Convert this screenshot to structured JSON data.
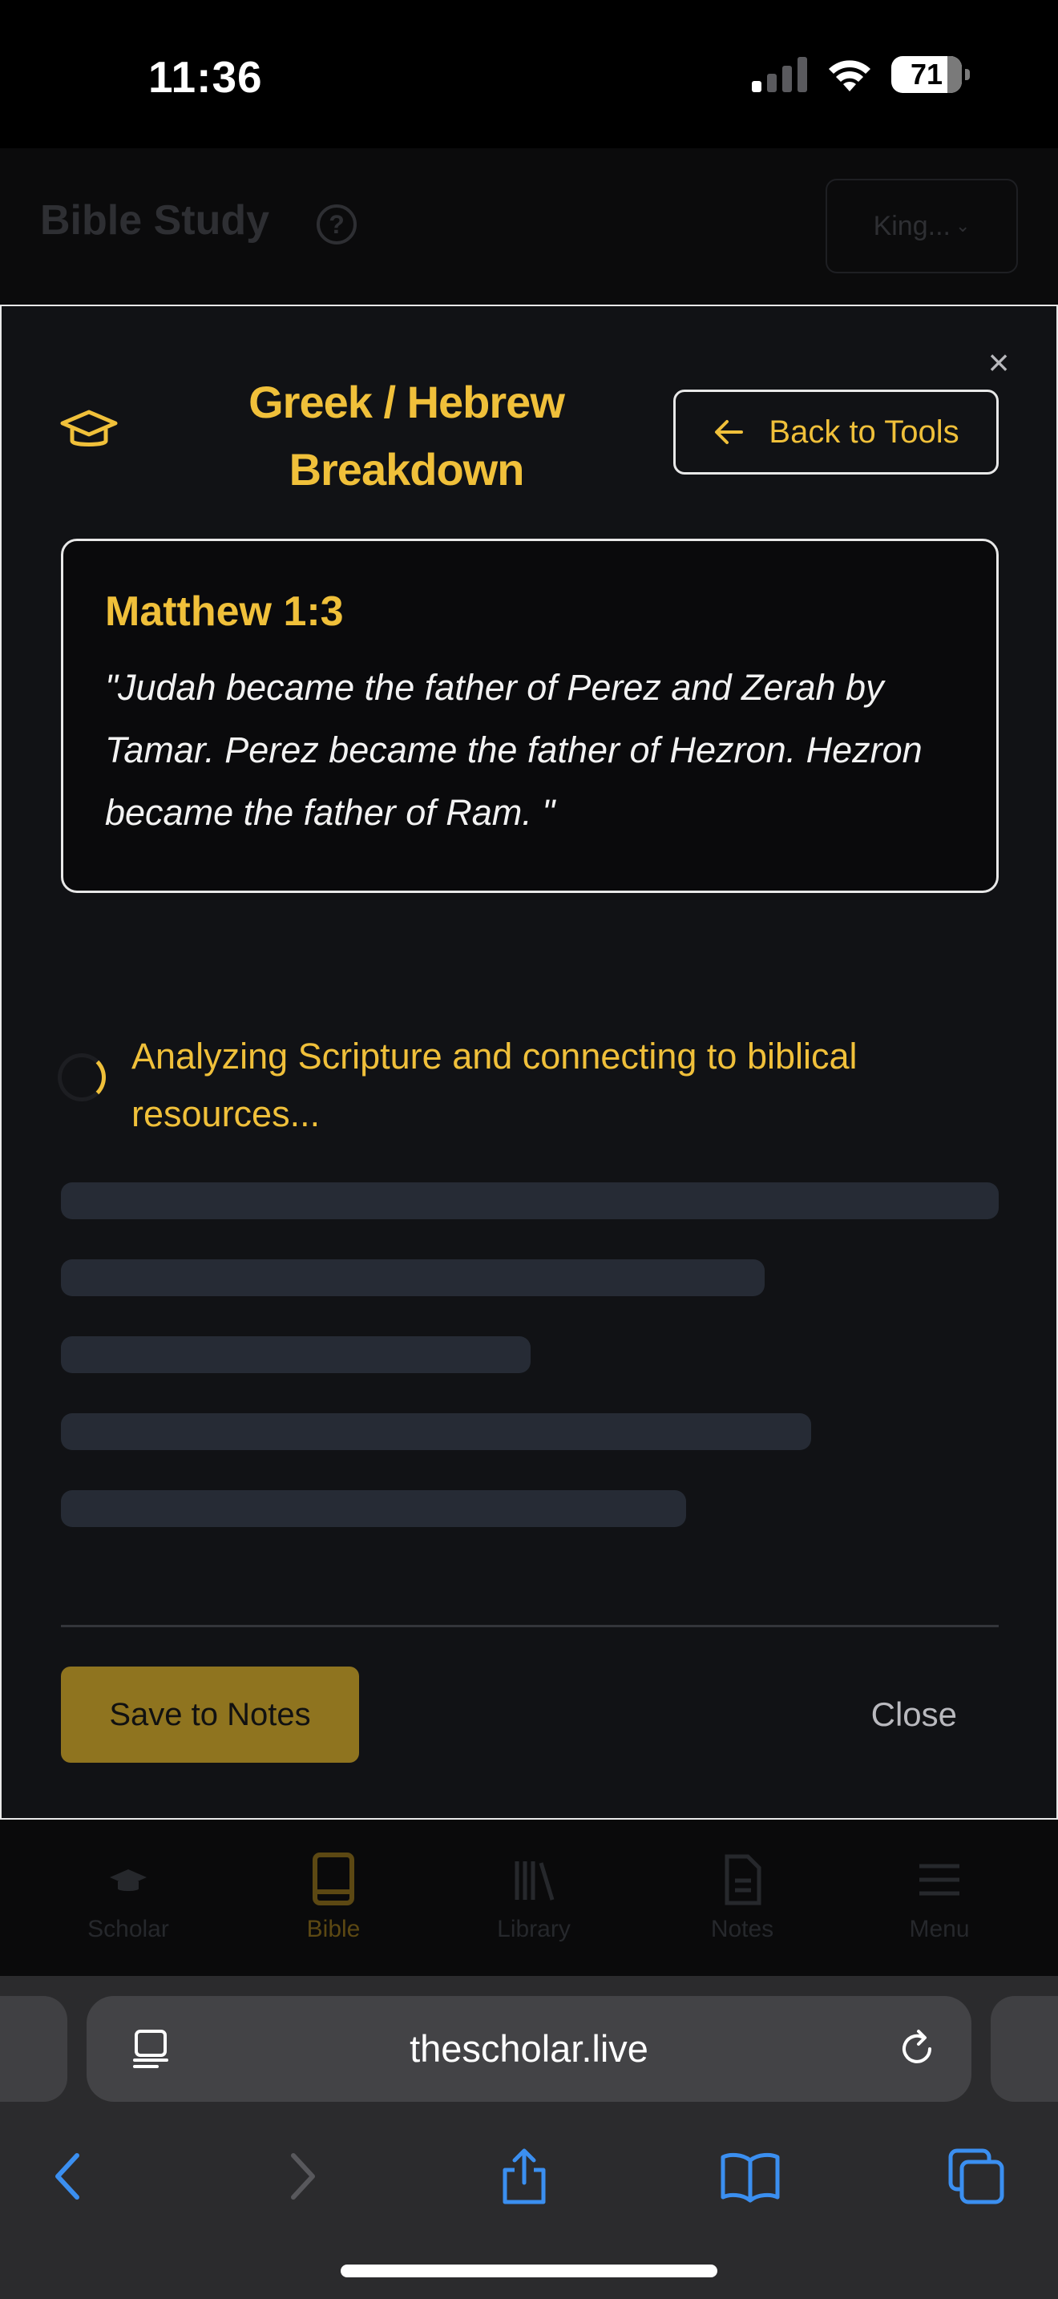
{
  "status_bar": {
    "time": "11:36",
    "battery": "71"
  },
  "header": {
    "title": "Bible Study",
    "help": "?",
    "version": "King...",
    "version_chevron": "⌄"
  },
  "modal": {
    "title": "Greek / Hebrew Breakdown",
    "back_label": "Back to Tools",
    "close_symbol": "×",
    "verse": {
      "reference": "Matthew 1:3",
      "text": "\"Judah became the father of Perez and Zerah by Tamar. Perez became the father of Hezron. Hezron became the father of Ram. \""
    },
    "loading_text": "Analyzing Scripture and connecting to biblical resources...",
    "save_label": "Save to Notes",
    "close_label": "Close"
  },
  "tabs": [
    {
      "label": "Scholar",
      "icon": "graduation-cap-icon"
    },
    {
      "label": "Bible",
      "icon": "book-icon",
      "active": true
    },
    {
      "label": "Library",
      "icon": "library-icon"
    },
    {
      "label": "Notes",
      "icon": "notes-icon"
    },
    {
      "label": "Menu",
      "icon": "menu-icon"
    }
  ],
  "browser": {
    "url": "thescholar.live"
  },
  "colors": {
    "accent": "#f0c03a",
    "accent_dim": "#8f741f",
    "background": "#111215",
    "skeleton": "#262b35",
    "link": "#3b8ff0"
  }
}
